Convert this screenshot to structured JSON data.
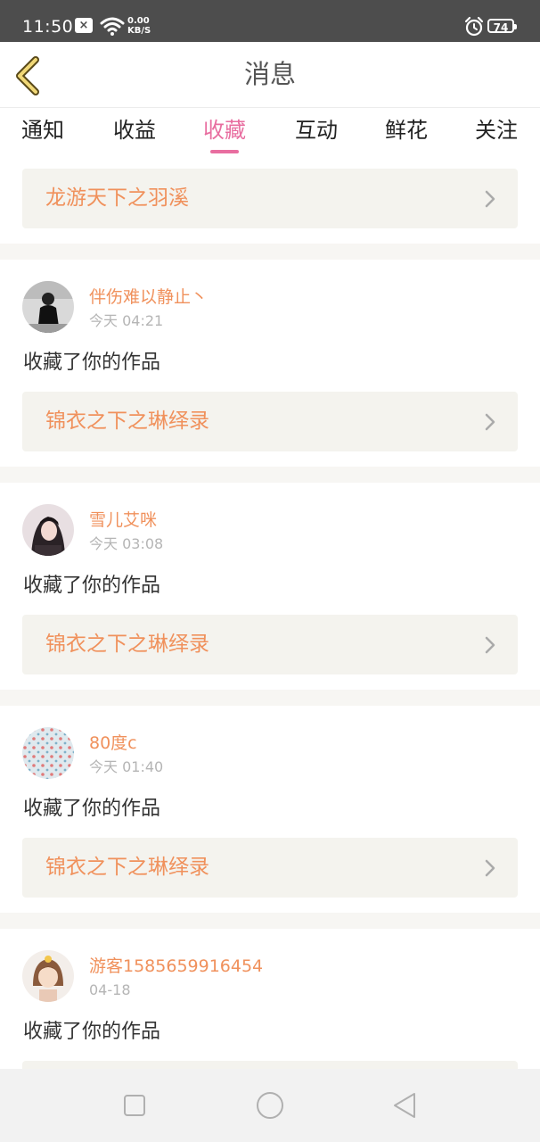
{
  "status_bar": {
    "time": "11:50",
    "notification_badge": "×",
    "net_speed_value": "0.00",
    "net_speed_unit": "KB/S",
    "battery": "74",
    "icons": [
      "close-notification-icon",
      "wifi-icon",
      "alarm-icon",
      "battery-icon"
    ]
  },
  "header": {
    "title": "消息",
    "back_icon": "chevron-left-icon"
  },
  "tabs": [
    {
      "label": "通知"
    },
    {
      "label": "收益"
    },
    {
      "label": "收藏",
      "active": true
    },
    {
      "label": "互动"
    },
    {
      "label": "鲜花"
    },
    {
      "label": "关注"
    }
  ],
  "colors": {
    "accent": "#e86ea0",
    "link": "#f0915c",
    "status_bar": "#4d4d4d",
    "card_bg": "#f4f3ee"
  },
  "top_card": {
    "title": "龙游天下之羽溪"
  },
  "feed": [
    {
      "username": "伴伤难以静止丶",
      "time": "今天 04:21",
      "message": "收藏了你的作品",
      "work": "锦衣之下之琳绎录"
    },
    {
      "username": "雪儿艾咪",
      "time": "今天 03:08",
      "message": "收藏了你的作品",
      "work": "锦衣之下之琳绎录"
    },
    {
      "username": "80度c",
      "time": "今天 01:40",
      "message": "收藏了你的作品",
      "work": "锦衣之下之琳绎录"
    },
    {
      "username": "游客1585659916454",
      "time": "04-18",
      "message": "收藏了你的作品",
      "work": ""
    }
  ],
  "nav_bar": {
    "icons": [
      "recents-square-icon",
      "home-circle-icon",
      "back-triangle-icon"
    ]
  }
}
